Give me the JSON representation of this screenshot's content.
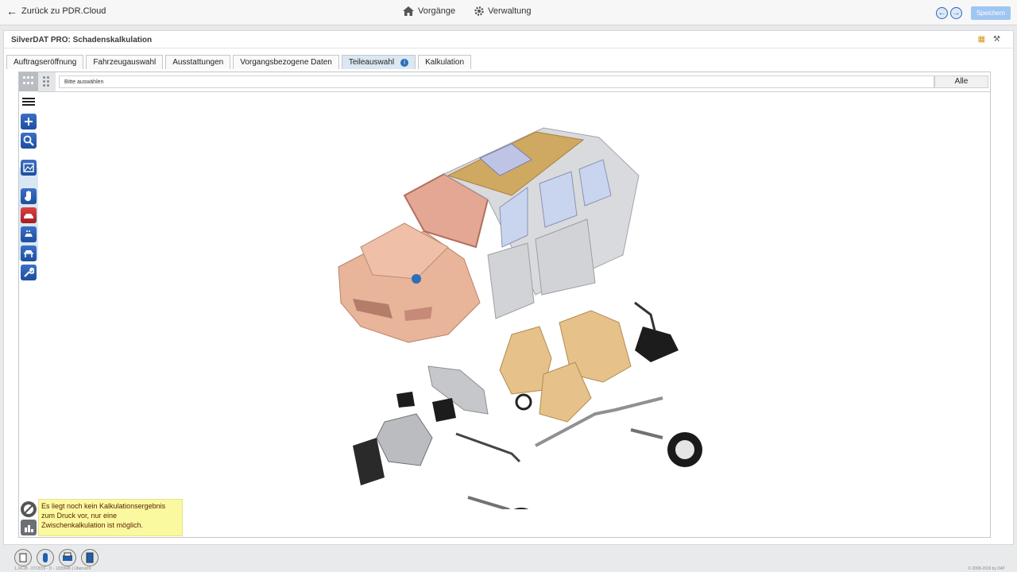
{
  "topbar": {
    "back_label": "Zurück zu PDR.Cloud",
    "nav_vorgaenge": "Vorgänge",
    "nav_verwaltung": "Verwaltung",
    "save_label": "Speichern"
  },
  "page": {
    "title": "SilverDAT PRO: Schadenskalkulation"
  },
  "tabs": [
    {
      "label": "Auftragseröffnung"
    },
    {
      "label": "Fahrzeugauswahl"
    },
    {
      "label": "Ausstattungen"
    },
    {
      "label": "Vorgangsbezogene Daten"
    },
    {
      "label": "Teileauswahl"
    },
    {
      "label": "Kalkulation"
    }
  ],
  "toolbar": {
    "select_placeholder": "Bitte auswählen",
    "alle_label": "Alle"
  },
  "message": {
    "text": "Es liegt noch kein Kalkulationsergebnis zum Druck vor, nur eine Zwischenkalkulation ist möglich."
  },
  "footer": {
    "version_info": "1.24.28 - 07/2019 - D - 1339645 | Übersicht",
    "copyright": "© 2008-2019 by DAT"
  },
  "colors": {
    "accent": "#2c6fb7",
    "active_tab": "#dbe8f3",
    "message_bg": "#fbf9a0",
    "body_panel_color": "#e8b49a",
    "seat_color": "#e7c18a"
  }
}
